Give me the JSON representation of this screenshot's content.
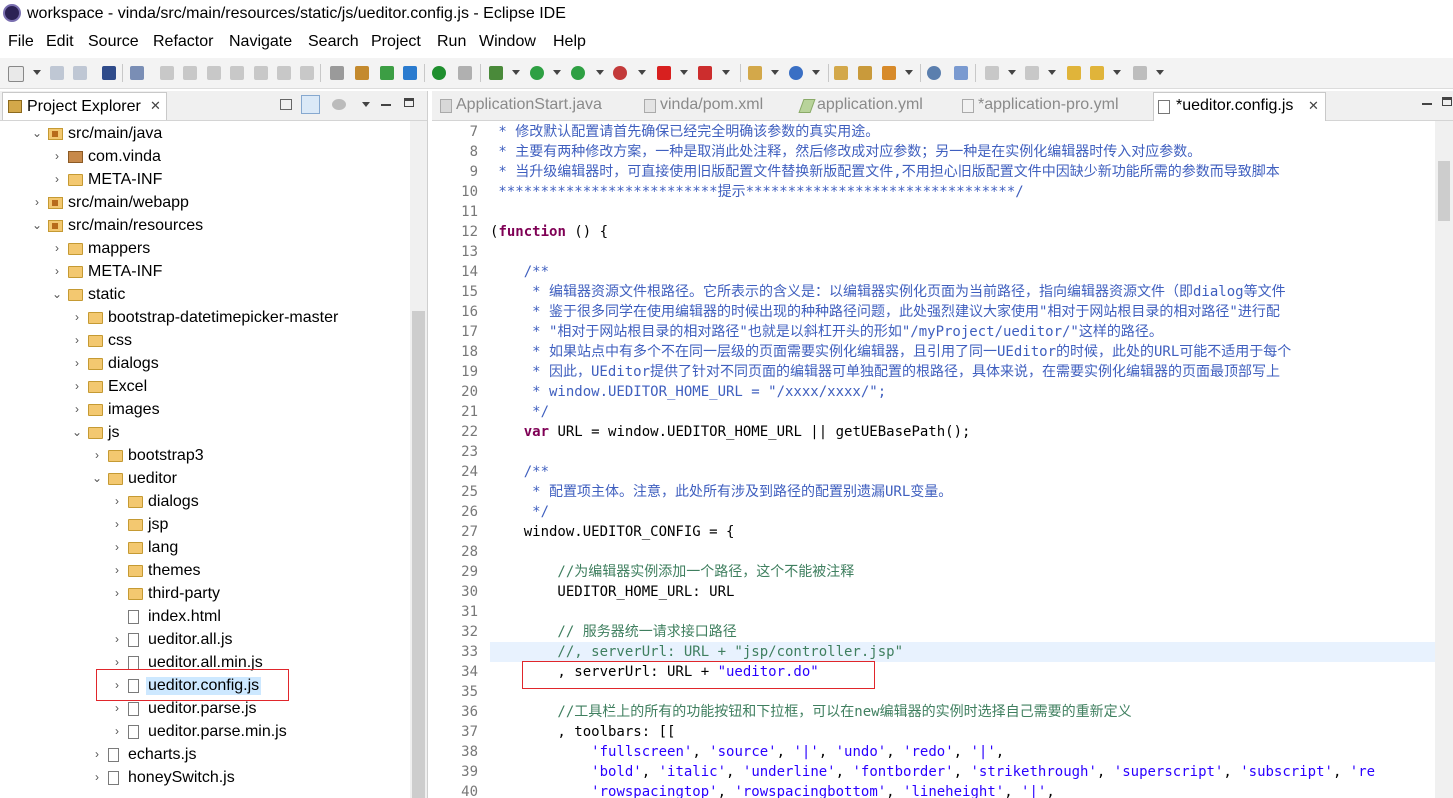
{
  "window": {
    "title": "workspace - vinda/src/main/resources/static/js/ueditor.config.js - Eclipse IDE"
  },
  "menu": [
    "File",
    "Edit",
    "Source",
    "Refactor",
    "Navigate",
    "Search",
    "Project",
    "Run",
    "Window",
    "Help"
  ],
  "explorer": {
    "tab_label": "Project Explorer",
    "close_glyph": "✕",
    "tree": [
      {
        "label": "src/main/java",
        "depth": 0,
        "expanded": true,
        "icon": "package-folder-icon"
      },
      {
        "label": "com.vinda",
        "depth": 1,
        "expanded": false,
        "icon": "package-icon"
      },
      {
        "label": "META-INF",
        "depth": 1,
        "expanded": false,
        "icon": "folder-icon"
      },
      {
        "label": "src/main/webapp",
        "depth": 0,
        "expanded": false,
        "icon": "package-folder-icon"
      },
      {
        "label": "src/main/resources",
        "depth": 0,
        "expanded": true,
        "icon": "package-folder-icon"
      },
      {
        "label": "mappers",
        "depth": 1,
        "expanded": false,
        "icon": "folder-icon"
      },
      {
        "label": "META-INF",
        "depth": 1,
        "expanded": false,
        "icon": "folder-icon"
      },
      {
        "label": "static",
        "depth": 1,
        "expanded": true,
        "icon": "folder-icon"
      },
      {
        "label": "bootstrap-datetimepicker-master",
        "depth": 2,
        "expanded": false,
        "icon": "folder-icon"
      },
      {
        "label": "css",
        "depth": 2,
        "expanded": false,
        "icon": "folder-icon"
      },
      {
        "label": "dialogs",
        "depth": 2,
        "expanded": false,
        "icon": "folder-icon"
      },
      {
        "label": "Excel",
        "depth": 2,
        "expanded": false,
        "icon": "folder-icon"
      },
      {
        "label": "images",
        "depth": 2,
        "expanded": false,
        "icon": "folder-icon"
      },
      {
        "label": "js",
        "depth": 2,
        "expanded": true,
        "icon": "folder-icon"
      },
      {
        "label": "bootstrap3",
        "depth": 3,
        "expanded": false,
        "icon": "folder-icon"
      },
      {
        "label": "ueditor",
        "depth": 3,
        "expanded": true,
        "icon": "folder-icon"
      },
      {
        "label": "dialogs",
        "depth": 4,
        "expanded": false,
        "icon": "folder-icon"
      },
      {
        "label": "jsp",
        "depth": 4,
        "expanded": false,
        "icon": "folder-icon"
      },
      {
        "label": "lang",
        "depth": 4,
        "expanded": false,
        "icon": "folder-icon"
      },
      {
        "label": "themes",
        "depth": 4,
        "expanded": false,
        "icon": "folder-icon"
      },
      {
        "label": "third-party",
        "depth": 4,
        "expanded": false,
        "icon": "folder-icon"
      },
      {
        "label": "index.html",
        "depth": 4,
        "expanded": null,
        "icon": "file-icon"
      },
      {
        "label": "ueditor.all.js",
        "depth": 4,
        "expanded": false,
        "icon": "file-icon"
      },
      {
        "label": "ueditor.all.min.js",
        "depth": 4,
        "expanded": false,
        "icon": "file-icon"
      },
      {
        "label": "ueditor.config.js",
        "depth": 4,
        "expanded": false,
        "icon": "file-icon",
        "selected": true
      },
      {
        "label": "ueditor.parse.js",
        "depth": 4,
        "expanded": false,
        "icon": "file-icon"
      },
      {
        "label": "ueditor.parse.min.js",
        "depth": 4,
        "expanded": false,
        "icon": "file-icon"
      },
      {
        "label": "echarts.js",
        "depth": 3,
        "expanded": false,
        "icon": "file-icon"
      },
      {
        "label": "honeySwitch.js",
        "depth": 3,
        "expanded": false,
        "icon": "file-icon"
      }
    ]
  },
  "editor_tabs": [
    {
      "label": "ApplicationStart.java",
      "active": false,
      "icon": "java-file-icon"
    },
    {
      "label": "vinda/pom.xml",
      "active": false,
      "icon": "xml-file-icon"
    },
    {
      "label": "application.yml",
      "active": false,
      "icon": "yaml-file-icon"
    },
    {
      "label": "*application-pro.yml",
      "active": false,
      "icon": "text-file-icon"
    },
    {
      "label": "*ueditor.config.js",
      "active": true,
      "icon": "js-file-icon"
    }
  ],
  "code_lines": [
    {
      "n": "7",
      "parts": [
        {
          "t": " * 修改默认配置请首先确保已经完全明确该参数的真实用途。",
          "c": "cmt"
        }
      ]
    },
    {
      "n": "8",
      "parts": [
        {
          "t": " * 主要有两种修改方案，一种是取消此处注释，然后修改成对应参数；另一种是在实例化编辑器时传入对应参数。",
          "c": "cmt"
        }
      ]
    },
    {
      "n": "9",
      "parts": [
        {
          "t": " * 当升级编辑器时，可直接使用旧版配置文件替换新版配置文件,不用担心旧版配置文件中因缺少新功能所需的参数而导致脚本",
          "c": "cmt"
        }
      ]
    },
    {
      "n": "10",
      "parts": [
        {
          "t": " **************************提示********************************/",
          "c": "cmt"
        }
      ]
    },
    {
      "n": "11",
      "parts": [
        {
          "t": "",
          "c": ""
        }
      ]
    },
    {
      "n": "12",
      "parts": [
        {
          "t": "(",
          "c": ""
        },
        {
          "t": "function",
          "c": "kw"
        },
        {
          "t": " () {",
          "c": ""
        }
      ]
    },
    {
      "n": "13",
      "parts": [
        {
          "t": "",
          "c": ""
        }
      ]
    },
    {
      "n": "14",
      "parts": [
        {
          "t": "    /**",
          "c": "cmt"
        }
      ]
    },
    {
      "n": "15",
      "parts": [
        {
          "t": "     * 编辑器资源文件根路径。它所表示的含义是：以编辑器实例化页面为当前路径，指向编辑器资源文件（即dialog等文件",
          "c": "cmt"
        }
      ]
    },
    {
      "n": "16",
      "parts": [
        {
          "t": "     * 鉴于很多同学在使用编辑器的时候出现的种种路径问题，此处强烈建议大家使用\"相对于网站根目录的相对路径\"进行配",
          "c": "cmt"
        }
      ]
    },
    {
      "n": "17",
      "parts": [
        {
          "t": "     * \"相对于网站根目录的相对路径\"也就是以斜杠开头的形如\"/myProject/ueditor/\"这样的路径。",
          "c": "cmt"
        }
      ]
    },
    {
      "n": "18",
      "parts": [
        {
          "t": "     * 如果站点中有多个不在同一层级的页面需要实例化编辑器，且引用了同一UEditor的时候，此处的URL可能不适用于每个",
          "c": "cmt"
        }
      ]
    },
    {
      "n": "19",
      "parts": [
        {
          "t": "     * 因此，UEditor提供了针对不同页面的编辑器可单独配置的根路径，具体来说，在需要实例化编辑器的页面最顶部写上",
          "c": "cmt"
        }
      ]
    },
    {
      "n": "20",
      "parts": [
        {
          "t": "     * window.UEDITOR_HOME_URL = \"/xxxx/xxxx/\";",
          "c": "cmt"
        }
      ]
    },
    {
      "n": "21",
      "parts": [
        {
          "t": "     */",
          "c": "cmt"
        }
      ]
    },
    {
      "n": "22",
      "parts": [
        {
          "t": "    ",
          "c": ""
        },
        {
          "t": "var",
          "c": "kw"
        },
        {
          "t": " URL = window.UEDITOR_HOME_URL || getUEBasePath();",
          "c": ""
        }
      ]
    },
    {
      "n": "23",
      "parts": [
        {
          "t": "",
          "c": ""
        }
      ]
    },
    {
      "n": "24",
      "parts": [
        {
          "t": "    /**",
          "c": "cmt"
        }
      ]
    },
    {
      "n": "25",
      "parts": [
        {
          "t": "     * 配置项主体。注意，此处所有涉及到路径的配置别遗漏URL变量。",
          "c": "cmt"
        }
      ]
    },
    {
      "n": "26",
      "parts": [
        {
          "t": "     */",
          "c": "cmt"
        }
      ]
    },
    {
      "n": "27",
      "parts": [
        {
          "t": "    window.UEDITOR_CONFIG = {",
          "c": ""
        }
      ]
    },
    {
      "n": "28",
      "parts": [
        {
          "t": "",
          "c": ""
        }
      ]
    },
    {
      "n": "29",
      "parts": [
        {
          "t": "        //为编辑器实例添加一个路径，这个不能被注释",
          "c": "cmt2"
        }
      ]
    },
    {
      "n": "30",
      "parts": [
        {
          "t": "        UEDITOR_HOME_URL: URL",
          "c": ""
        }
      ]
    },
    {
      "n": "31",
      "parts": [
        {
          "t": "",
          "c": ""
        }
      ]
    },
    {
      "n": "32",
      "parts": [
        {
          "t": "        // 服务器统一请求接口路径",
          "c": "cmt2"
        }
      ]
    },
    {
      "n": "33",
      "parts": [
        {
          "t": "        //, serverUrl: URL + \"jsp/controller.jsp\"",
          "c": "cmt2"
        }
      ],
      "highlight": true
    },
    {
      "n": "34",
      "parts": [
        {
          "t": "        , serverUrl: URL + ",
          "c": ""
        },
        {
          "t": "\"ueditor.do\"",
          "c": "str"
        }
      ]
    },
    {
      "n": "35",
      "parts": [
        {
          "t": "",
          "c": ""
        }
      ]
    },
    {
      "n": "36",
      "parts": [
        {
          "t": "        //工具栏上的所有的功能按钮和下拉框，可以在new编辑器的实例时选择自己需要的重新定义",
          "c": "cmt2"
        }
      ]
    },
    {
      "n": "37",
      "parts": [
        {
          "t": "        , toolbars: [[",
          "c": ""
        }
      ]
    },
    {
      "n": "38",
      "parts": [
        {
          "t": "            ",
          "c": ""
        },
        {
          "t": "'fullscreen'",
          "c": "str"
        },
        {
          "t": ", ",
          "c": ""
        },
        {
          "t": "'source'",
          "c": "str"
        },
        {
          "t": ", ",
          "c": ""
        },
        {
          "t": "'|'",
          "c": "str"
        },
        {
          "t": ", ",
          "c": ""
        },
        {
          "t": "'undo'",
          "c": "str"
        },
        {
          "t": ", ",
          "c": ""
        },
        {
          "t": "'redo'",
          "c": "str"
        },
        {
          "t": ", ",
          "c": ""
        },
        {
          "t": "'|'",
          "c": "str"
        },
        {
          "t": ",",
          "c": ""
        }
      ]
    },
    {
      "n": "39",
      "parts": [
        {
          "t": "            ",
          "c": ""
        },
        {
          "t": "'bold'",
          "c": "str"
        },
        {
          "t": ", ",
          "c": ""
        },
        {
          "t": "'italic'",
          "c": "str"
        },
        {
          "t": ", ",
          "c": ""
        },
        {
          "t": "'underline'",
          "c": "str"
        },
        {
          "t": ", ",
          "c": ""
        },
        {
          "t": "'fontborder'",
          "c": "str"
        },
        {
          "t": ", ",
          "c": ""
        },
        {
          "t": "'strikethrough'",
          "c": "str"
        },
        {
          "t": ", ",
          "c": ""
        },
        {
          "t": "'superscript'",
          "c": "str"
        },
        {
          "t": ", ",
          "c": ""
        },
        {
          "t": "'subscript'",
          "c": "str"
        },
        {
          "t": ", ",
          "c": ""
        },
        {
          "t": "'re",
          "c": "str"
        }
      ]
    },
    {
      "n": "40",
      "parts": [
        {
          "t": "            ",
          "c": ""
        },
        {
          "t": "'rowspacingtop'",
          "c": "str"
        },
        {
          "t": ", ",
          "c": ""
        },
        {
          "t": "'rowspacingbottom'",
          "c": "str"
        },
        {
          "t": ", ",
          "c": ""
        },
        {
          "t": "'lineheight'",
          "c": "str"
        },
        {
          "t": ", ",
          "c": ""
        },
        {
          "t": "'|'",
          "c": "str"
        },
        {
          "t": ",",
          "c": ""
        }
      ]
    }
  ]
}
